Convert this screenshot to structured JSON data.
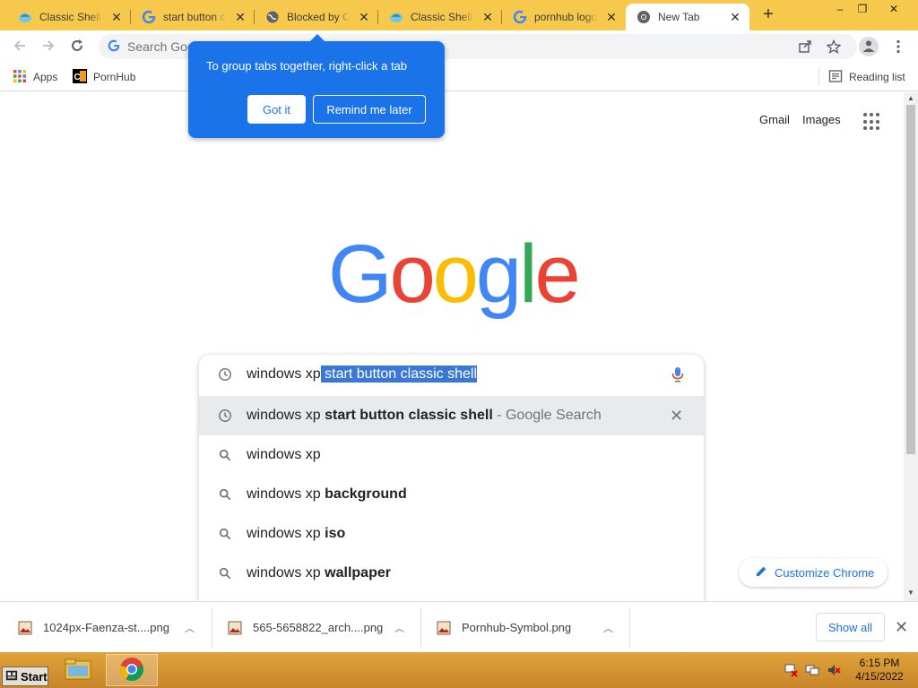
{
  "tabs": [
    {
      "title": "Classic Shell - ",
      "icon": "shell-favicon-icon"
    },
    {
      "title": "start button cl",
      "icon": "google-favicon-icon"
    },
    {
      "title": "Blocked by Chr",
      "icon": "globe-favicon-icon"
    },
    {
      "title": "Classic Shell - ",
      "icon": "shell-favicon-icon"
    },
    {
      "title": "pornhub logo",
      "icon": "google-favicon-icon"
    },
    {
      "title": "New Tab",
      "icon": "chrome-favicon-icon",
      "active": true
    }
  ],
  "tab_close_glyph": "✕",
  "new_tab_glyph": "+",
  "window_controls": {
    "minimize": "–",
    "maximize": "❐",
    "close": "✕"
  },
  "omnibox": {
    "placeholder": "Search Google or type a URL",
    "value": ""
  },
  "bookmarks": [
    {
      "label": "Apps",
      "icon": "apps-grid-icon"
    },
    {
      "label": "PornHub",
      "icon": "ph-favicon-icon"
    }
  ],
  "reading_list": "Reading list",
  "popup": {
    "message": "To group tabs together, right-click a tab",
    "got_it": "Got it",
    "remind_later": "Remind me later"
  },
  "header_links": {
    "gmail": "Gmail",
    "images": "Images"
  },
  "logo_letters": [
    {
      "char": "G",
      "color": "#4285f4"
    },
    {
      "char": "o",
      "color": "#ea4335"
    },
    {
      "char": "o",
      "color": "#fbbc05"
    },
    {
      "char": "g",
      "color": "#4285f4"
    },
    {
      "char": "l",
      "color": "#34a853"
    },
    {
      "char": "e",
      "color": "#ea4335"
    }
  ],
  "search": {
    "typed": "windows xp",
    "autocomplete_selected": " start button classic shell"
  },
  "suggestions": [
    {
      "prefix": "windows xp ",
      "bold": "start button classic shell",
      "suffix": " - Google Search",
      "icon": "history-icon",
      "highlighted": true
    },
    {
      "prefix": "windows xp",
      "bold": "",
      "suffix": "",
      "icon": "search-icon"
    },
    {
      "prefix": "windows xp ",
      "bold": "background",
      "suffix": "",
      "icon": "search-icon"
    },
    {
      "prefix": "windows xp ",
      "bold": "iso",
      "suffix": "",
      "icon": "search-icon"
    },
    {
      "prefix": "windows xp ",
      "bold": "wallpaper",
      "suffix": "",
      "icon": "search-icon"
    }
  ],
  "customize_chrome": "Customize Chrome",
  "downloads": [
    {
      "name": "1024px-Faenza-st....png"
    },
    {
      "name": "565-5658822_arch....png"
    },
    {
      "name": "Pornhub-Symbol.png"
    }
  ],
  "show_all": "Show all",
  "taskbar": {
    "start_label": "Start",
    "time": "6:15 PM",
    "date": "4/15/2022"
  },
  "colors": {
    "tabstrip": "#f6c84c",
    "accent": "#1a73e8",
    "selection": "#3a78d6"
  }
}
